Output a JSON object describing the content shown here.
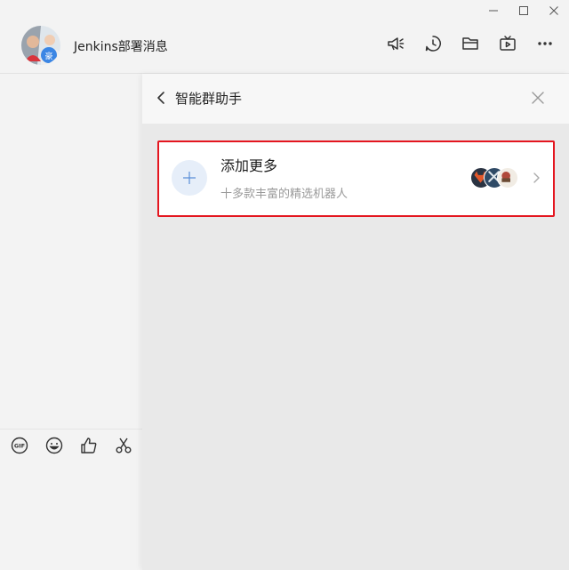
{
  "header": {
    "title": "Jenkins部署消息",
    "icons": [
      "announcement-icon",
      "history-icon",
      "folder-icon",
      "video-icon",
      "more-icon"
    ]
  },
  "window": {
    "controls": [
      "minimize-icon",
      "maximize-icon",
      "close-icon"
    ]
  },
  "panel": {
    "title": "智能群助手",
    "card": {
      "title": "添加更多",
      "subtitle": "十多款丰富的精选机器人"
    }
  },
  "toolbar": {
    "icons": [
      "gif-icon",
      "emoji-icon",
      "thumbs-up-icon",
      "scissors-icon"
    ]
  },
  "colors": {
    "highlight_border": "#e4161f",
    "add_circle_bg": "#e6eef9",
    "add_plus": "#5a8fd8",
    "panel_bg": "#e9e9e9",
    "app_bg": "#f3f3f3"
  }
}
